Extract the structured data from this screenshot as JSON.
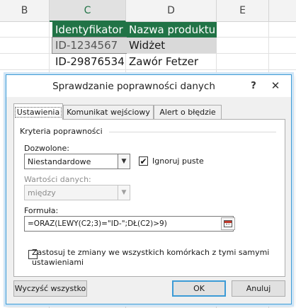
{
  "spreadsheet": {
    "columns": [
      "B",
      "C",
      "D",
      "E"
    ],
    "selected_column": "C",
    "header_row": {
      "c": "Identyfikator",
      "d": "Nazwa produktu"
    },
    "rows": [
      {
        "c": "ID-1234567",
        "d": "Widżet"
      },
      {
        "c": "ID-29876534",
        "d": "Zawór Fetzer"
      }
    ],
    "colors": {
      "header_fill": "#217346",
      "header_text": "#ffffff",
      "row_highlight": "#d9d9d9"
    }
  },
  "dialog": {
    "title": "Sprawdzanie poprawności danych",
    "help_icon": "question-mark",
    "close_icon": "close-x",
    "tabs": [
      "Ustawienia",
      "Komunikat wejściowy",
      "Alert o błędzie"
    ],
    "active_tab": "Ustawienia",
    "group_label": "Kryteria poprawności",
    "allow_label": "Dozwolone:",
    "allow_value": "Niestandardowe",
    "ignore_blank_label": "Ignoruj puste",
    "ignore_blank_checked": true,
    "check_mark": "✔",
    "data_label": "Wartości danych:",
    "data_value": "między",
    "formula_label": "Formuła:",
    "formula_value": "=ORAZ(LEWY(C2;3)=\"ID-\";DŁ(C2)>9)",
    "apply_all_label": "Zastosuj te zmiany we wszystkich komórkach z tymi samymi ustawieniami",
    "apply_all_checked": false,
    "clear_all_button": "Wyczyść wszystko",
    "ok_button": "OK",
    "cancel_button": "Anuluj",
    "accent_color": "#3c9bd6"
  }
}
